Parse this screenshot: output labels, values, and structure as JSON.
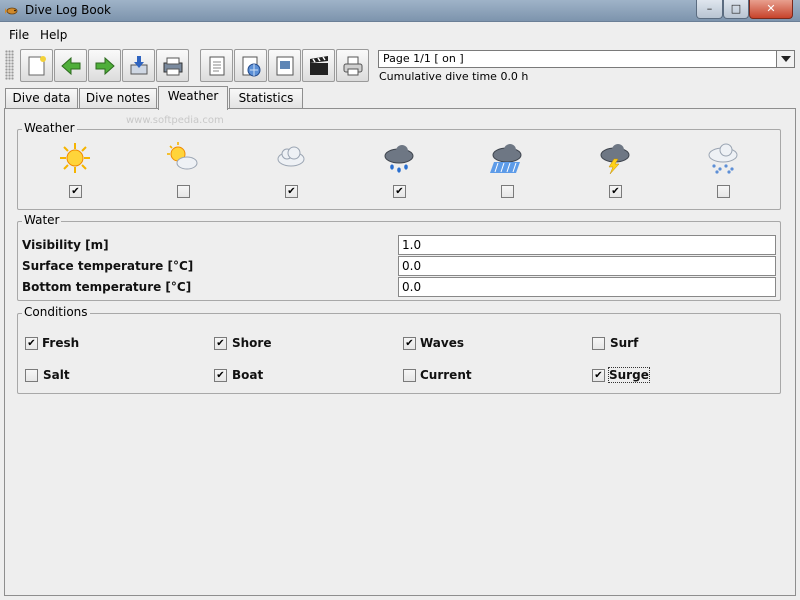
{
  "window": {
    "title": "Dive Log Book",
    "minimize": "–",
    "maximize": "□",
    "close": "✕"
  },
  "menu": {
    "file": "File",
    "help": "Help"
  },
  "toolbar": {
    "buttons": [
      "new-entry-icon",
      "back-arrow-icon",
      "forward-arrow-icon",
      "import-icon",
      "print-list-icon",
      "document-icon",
      "world-document-icon",
      "picture-icon",
      "clapper-icon",
      "printer-icon"
    ],
    "page_selector": "Page 1/1 [ on ]",
    "cumulative": "Cumulative dive time 0.0 h"
  },
  "tabs": [
    {
      "label": "Dive data",
      "active": false
    },
    {
      "label": "Dive notes",
      "active": false
    },
    {
      "label": "Weather",
      "active": true
    },
    {
      "label": "Statistics",
      "active": false
    }
  ],
  "watermark": "www.softpedia.com",
  "weather": {
    "title": "Weather",
    "items": [
      {
        "icon": "sun-icon",
        "checked": true
      },
      {
        "icon": "partly-cloudy-icon",
        "checked": false
      },
      {
        "icon": "cloudy-icon",
        "checked": true
      },
      {
        "icon": "rain-icon",
        "checked": true
      },
      {
        "icon": "heavy-rain-icon",
        "checked": false
      },
      {
        "icon": "thunderstorm-icon",
        "checked": true
      },
      {
        "icon": "snow-icon",
        "checked": false
      }
    ]
  },
  "water": {
    "title": "Water",
    "fields": [
      {
        "label": "Visibility [m]",
        "value": "1.0"
      },
      {
        "label": "Surface temperature [°C]",
        "value": "0.0"
      },
      {
        "label": "Bottom temperature [°C]",
        "value": "0.0"
      }
    ]
  },
  "conditions": {
    "title": "Conditions",
    "items": [
      {
        "label": "Fresh",
        "checked": true
      },
      {
        "label": "Shore",
        "checked": true
      },
      {
        "label": "Waves",
        "checked": true
      },
      {
        "label": "Surf",
        "checked": false
      },
      {
        "label": "Salt",
        "checked": false
      },
      {
        "label": "Boat",
        "checked": true
      },
      {
        "label": "Current",
        "checked": false
      },
      {
        "label": "Surge",
        "checked": true
      }
    ]
  },
  "checkmark": "✔"
}
